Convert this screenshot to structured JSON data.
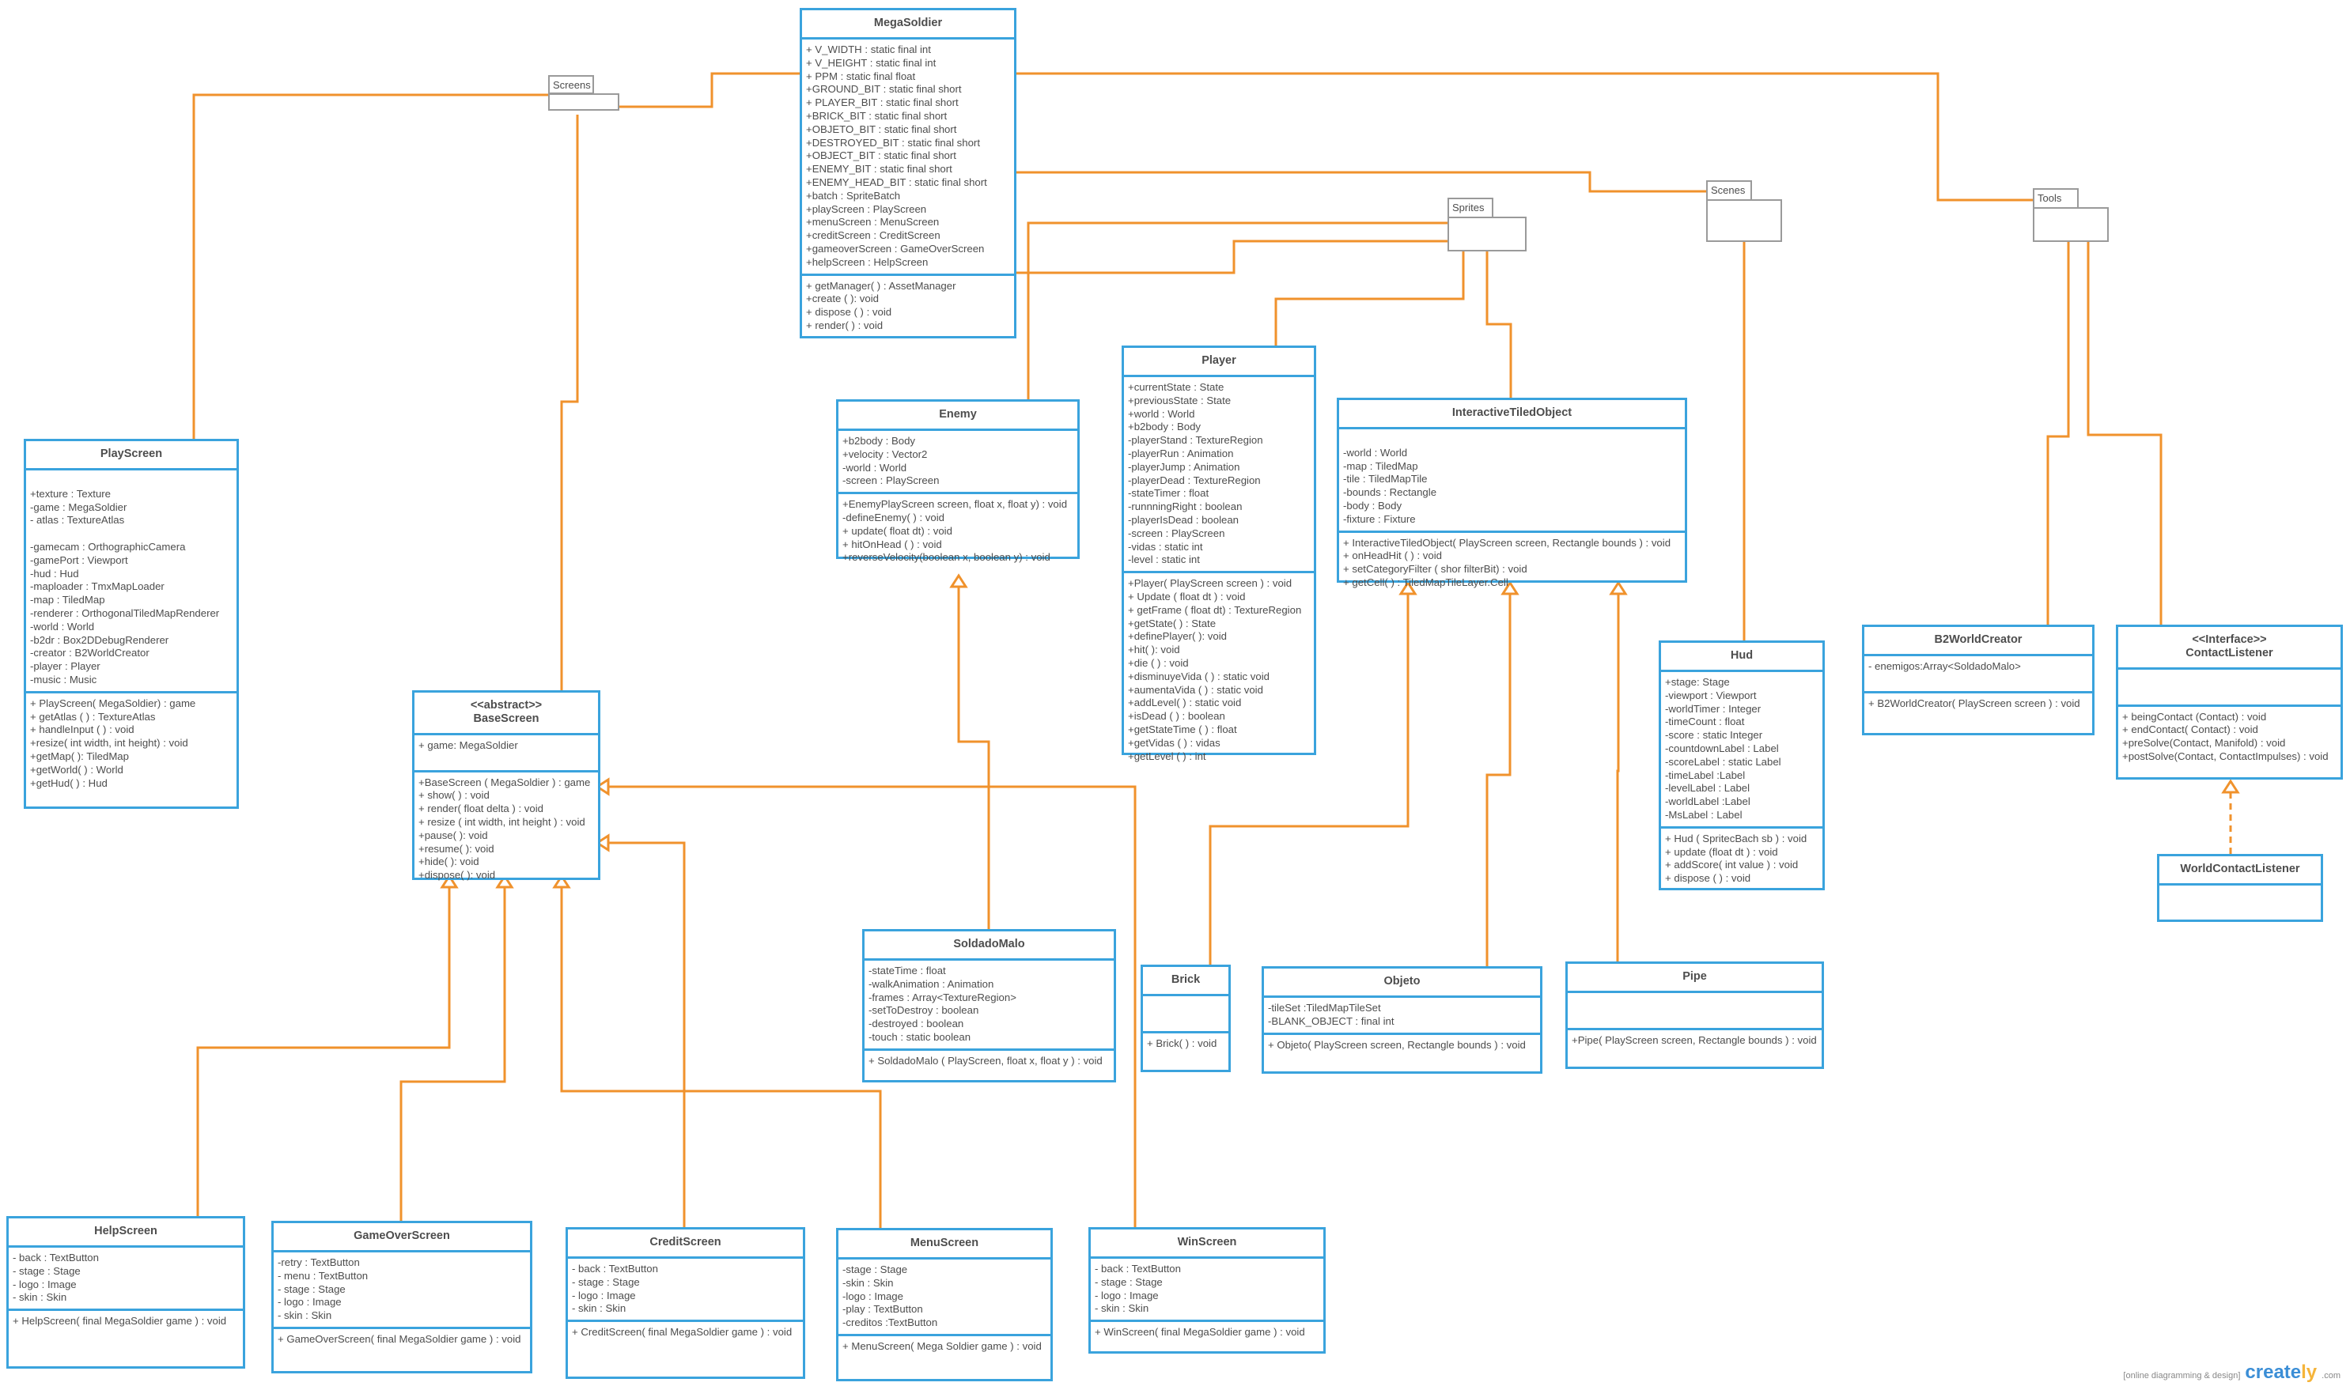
{
  "colors": {
    "class_border": "#3aa3dd",
    "connector": "#f0922c",
    "package_border": "#9a9a9a",
    "text": "#4d4d4d"
  },
  "packages": [
    {
      "id": "screens",
      "label": "Screens"
    },
    {
      "id": "sprites",
      "label": "Sprites"
    },
    {
      "id": "scenes",
      "label": "Scenes"
    },
    {
      "id": "tools",
      "label": "Tools"
    }
  ],
  "classes": {
    "megasoldier": {
      "name": "MegaSoldier",
      "attributes": [
        "+ V_WIDTH : static final int",
        "+ V_HEIGHT : static final int",
        "+ PPM : static final float",
        "+GROUND_BIT : static final short",
        "+ PLAYER_BIT : static final short",
        "+BRICK_BIT : static final short",
        "+OBJETO_BIT : static final short",
        "+DESTROYED_BIT : static final short",
        "+OBJECT_BIT : static final short",
        "+ENEMY_BIT : static final short",
        "+ENEMY_HEAD_BIT : static final short",
        "+batch : SpriteBatch",
        "+playScreen : PlayScreen",
        "+menuScreen : MenuScreen",
        "+creditScreen : CreditScreen",
        "+gameoverScreen : GameOverScreen",
        "+helpScreen : HelpScreen"
      ],
      "operations": [
        "+ getManager( ) : AssetManager",
        "+create ( ): void",
        "+ dispose ( ) : void",
        "+ render( ) : void"
      ]
    },
    "playscreen": {
      "name": "PlayScreen",
      "attributes": [
        "",
        "+texture : Texture",
        "-game : MegaSoldier",
        "- atlas : TextureAtlas",
        "",
        "-gamecam : OrthographicCamera",
        "-gamePort : Viewport",
        "-hud : Hud",
        "-maploader : TmxMapLoader",
        "-map : TiledMap",
        "-renderer : OrthogonalTiledMapRenderer",
        "-world : World",
        "-b2dr : Box2DDebugRenderer",
        "-creator : B2WorldCreator",
        "-player : Player",
        "-music : Music"
      ],
      "operations": [
        "+ PlayScreen( MegaSoldier) : game",
        "+ getAtlas ( ) : TextureAtlas",
        "+ handleInput ( ) : void",
        "+resize( int width, int height) : void",
        "+getMap( ): TiledMap",
        "+getWorld( ) : World",
        "+getHud( ) : Hud"
      ]
    },
    "basescreen": {
      "stereotype": "<<abstract>>",
      "name": "BaseScreen",
      "attributes": [
        "+ game: MegaSoldier",
        ""
      ],
      "operations": [
        "+BaseScreen ( MegaSoldier ) : game",
        "+ show( ) : void",
        "+ render( float delta ) : void",
        "+ resize ( int width, int height ) : void",
        "+pause( ): void",
        "+resume( ): void",
        "+hide( ): void",
        "+dispose( ): void"
      ]
    },
    "enemy": {
      "name": "Enemy",
      "attributes": [
        "+b2body : Body",
        "+velocity : Vector2",
        "-world : World",
        "-screen : PlayScreen"
      ],
      "operations": [
        "+EnemyPlayScreen screen, float x, float y) : void",
        "-defineEnemy(  ) : void",
        "+ update( float dt) : void",
        "+ hitOnHead (  ) : void",
        "+reverseVelocity(boolean x, boolean y) : void"
      ]
    },
    "player": {
      "name": "Player",
      "attributes": [
        "+currentState : State",
        "+previousState : State",
        "+world : World",
        "+b2body : Body",
        "-playerStand : TextureRegion",
        "-playerRun : Animation",
        "-playerJump : Animation",
        "-playerDead : TextureRegion",
        "-stateTimer : float",
        "-runnningRight : boolean",
        "-playerIsDead : boolean",
        "-screen : PlayScreen",
        "-vidas : static int",
        "-level : static int"
      ],
      "operations": [
        "+Player( PlayScreen screen ) : void",
        "+ Update ( float dt ) : void",
        "+ getFrame ( float dt) : TextureRegion",
        "+getState(  ) : State",
        "+definePlayer( ): void",
        "+hit( ): void",
        "+die ( ) : void",
        "+disminuyeVida ( ) : static void",
        "+aumentaVida ( ) : static void",
        "+addLevel( ) : static void",
        "+isDead ( ) : boolean",
        "+getStateTime ( ) : float",
        "+getVidas ( ) : vidas",
        "+getLevel ( ) : int"
      ]
    },
    "interactivetiledobject": {
      "name": "InteractiveTiledObject",
      "attributes": [
        "",
        "-world : World",
        "-map : TiledMap",
        "-tile :  TiledMapTile",
        "-bounds : Rectangle",
        "-body : Body",
        "-fixture : Fixture"
      ],
      "operations": [
        "+ InteractiveTiledObject( PlayScreen screen, Rectangle bounds ) : void",
        "+ onHeadHit (  ) : void",
        "+ setCategoryFilter ( shor filterBit) : void",
        "+  getCell(  ) : TiledMapTileLayer.Cell"
      ]
    },
    "hud": {
      "name": "Hud",
      "attributes": [
        "+stage: Stage",
        "-viewport : Viewport",
        "-worldTimer : Integer",
        "-timeCount : float",
        "-score : static Integer",
        "-countdownLabel : Label",
        "-scoreLabel : static Label",
        "-timeLabel :Label",
        "-levelLabel : Label",
        "-worldLabel :Label",
        "-MsLabel : Label"
      ],
      "operations": [
        "+ Hud ( SpritecBach sb ) : void",
        "+ update (float dt ) : void",
        "+ addScore( int value ) : void",
        "+ dispose (  ) : void"
      ]
    },
    "b2worldcreator": {
      "name": "B2WorldCreator",
      "attributes": [
        "- enemigos:Array<SoldadoMalo>",
        ""
      ],
      "operations": [
        "+ B2WorldCreator( PlayScreen screen ) : void"
      ]
    },
    "contactlistener": {
      "stereotype": "<<Interface>>",
      "name": "ContactListener",
      "attributes": [
        "",
        ""
      ],
      "operations": [
        "+ beingContact (Contact) : void",
        "+ endContact( Contact) : void",
        "+preSolve(Contact, Manifold) : void",
        "+postSolve(Contact, ContactImpulses) : void"
      ]
    },
    "worldcontactlistener": {
      "name": "WorldContactListener",
      "attributes": [],
      "operations": [
        ""
      ]
    },
    "soldadomalo": {
      "name": "SoldadoMalo",
      "attributes": [
        "-stateTime : float",
        "-walkAnimation : Animation",
        "-frames : Array<TextureRegion>",
        "-setToDestroy : boolean",
        "-destroyed : boolean",
        "-touch : static boolean"
      ],
      "operations": [
        "+ SoldadoMalo ( PlayScreen, float x, float y ) : void"
      ]
    },
    "brick": {
      "name": "Brick",
      "attributes": [
        "",
        ""
      ],
      "operations": [
        "+ Brick( ) : void"
      ]
    },
    "objeto": {
      "name": "Objeto",
      "attributes": [
        "-tileSet :TiledMapTileSet",
        "-BLANK_OBJECT : final int"
      ],
      "operations": [
        "+ Objeto( PlayScreen screen, Rectangle bounds ) : void"
      ]
    },
    "pipe": {
      "name": "Pipe",
      "attributes": [
        "",
        ""
      ],
      "operations": [
        "+Pipe( PlayScreen screen, Rectangle bounds ) : void"
      ]
    },
    "helpscreen": {
      "name": "HelpScreen",
      "attributes": [
        "- back : TextButton",
        "- stage : Stage",
        "- logo : Image",
        "- skin : Skin"
      ],
      "operations": [
        "+ HelpScreen( final MegaSoldier game ) : void"
      ]
    },
    "gameoverscreen": {
      "name": "GameOverScreen",
      "attributes": [
        "-retry : TextButton",
        "- menu : TextButton",
        "- stage : Stage",
        "- logo : Image",
        "- skin : Skin"
      ],
      "operations": [
        "+ GameOverScreen( final MegaSoldier game ) : void"
      ]
    },
    "creditscreen": {
      "name": "CreditScreen",
      "attributes": [
        "- back : TextButton",
        "- stage : Stage",
        "- logo : Image",
        "- skin : Skin"
      ],
      "operations": [
        "+ CreditScreen( final MegaSoldier game ) : void"
      ]
    },
    "menuscreen": {
      "name": "MenuScreen",
      "attributes": [
        "-stage : Stage",
        "-skin : Skin",
        "-logo : Image",
        "-play : TextButton",
        "-creditos :TextButton"
      ],
      "operations": [
        "+ MenuScreen( Mega Soldier game ) : void"
      ]
    },
    "winscreen": {
      "name": "WinScreen",
      "attributes": [
        "- back : TextButton",
        "- stage : Stage",
        "- logo : Image",
        "- skin : Skin"
      ],
      "operations": [
        "+ WinScreen( final MegaSoldier game ) : void"
      ]
    }
  },
  "relationships": [
    {
      "from": "MegaSoldier",
      "to": "Screens",
      "type": "association"
    },
    {
      "from": "MegaSoldier",
      "to": "Sprites",
      "type": "association"
    },
    {
      "from": "MegaSoldier",
      "to": "Scenes",
      "type": "association"
    },
    {
      "from": "MegaSoldier",
      "to": "Tools",
      "type": "association"
    },
    {
      "from": "Screens",
      "to": "PlayScreen",
      "type": "association"
    },
    {
      "from": "Screens",
      "to": "BaseScreen",
      "type": "association"
    },
    {
      "from": "Sprites",
      "to": "Enemy",
      "type": "association"
    },
    {
      "from": "Sprites",
      "to": "Player",
      "type": "association"
    },
    {
      "from": "Sprites",
      "to": "InteractiveTiledObject",
      "type": "association"
    },
    {
      "from": "Scenes",
      "to": "Hud",
      "type": "association"
    },
    {
      "from": "Tools",
      "to": "B2WorldCreator",
      "type": "association"
    },
    {
      "from": "Tools",
      "to": "ContactListener",
      "type": "association"
    },
    {
      "from": "SoldadoMalo",
      "to": "Enemy",
      "type": "generalization"
    },
    {
      "from": "Brick",
      "to": "InteractiveTiledObject",
      "type": "generalization"
    },
    {
      "from": "Objeto",
      "to": "InteractiveTiledObject",
      "type": "generalization"
    },
    {
      "from": "Pipe",
      "to": "InteractiveTiledObject",
      "type": "generalization"
    },
    {
      "from": "HelpScreen",
      "to": "BaseScreen",
      "type": "generalization"
    },
    {
      "from": "GameOverScreen",
      "to": "BaseScreen",
      "type": "generalization"
    },
    {
      "from": "CreditScreen",
      "to": "BaseScreen",
      "type": "generalization"
    },
    {
      "from": "MenuScreen",
      "to": "BaseScreen",
      "type": "generalization"
    },
    {
      "from": "WinScreen",
      "to": "BaseScreen",
      "type": "generalization"
    },
    {
      "from": "WorldContactListener",
      "to": "ContactListener",
      "type": "realization"
    }
  ],
  "watermark": {
    "tagline": "[online diagramming & design]",
    "brand_main": "create",
    "brand_accent": "ly",
    "domain": ".com"
  }
}
